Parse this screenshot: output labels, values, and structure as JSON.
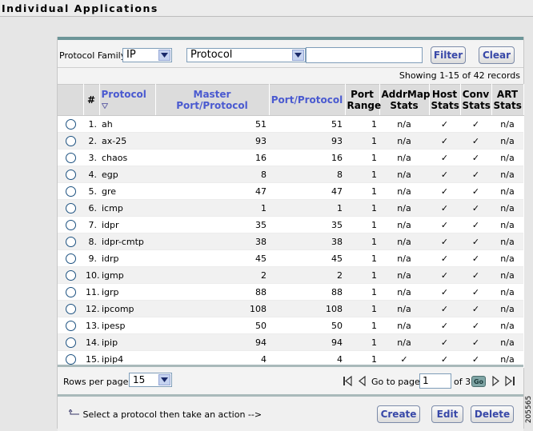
{
  "title": "Individual Applications",
  "filter": {
    "protocol_family_label": "Protocol Family:",
    "protocol_family_value": "IP",
    "field_value": "Protocol",
    "text_value": "",
    "filter_label": "Filter",
    "clear_label": "Clear"
  },
  "showing": "Showing 1-15 of 42 records",
  "columns": {
    "num": "#",
    "protocol": "Protocol",
    "master_port": "Master Port/Protocol",
    "port_protocol": "Port/Protocol",
    "port_range_1": "Port",
    "port_range_2": "Range",
    "addrmap_1": "AddrMap",
    "addrmap_2": "Stats",
    "host_1": "Host",
    "host_2": "Stats",
    "conv_1": "Conv",
    "conv_2": "Stats",
    "art_1": "ART",
    "art_2": "Stats"
  },
  "rows": [
    {
      "n": "1.",
      "protocol": "ah",
      "master": "51",
      "port": "51",
      "range": "1",
      "addrmap": "n/a",
      "host": "✓",
      "conv": "✓",
      "art": "n/a"
    },
    {
      "n": "2.",
      "protocol": "ax-25",
      "master": "93",
      "port": "93",
      "range": "1",
      "addrmap": "n/a",
      "host": "✓",
      "conv": "✓",
      "art": "n/a"
    },
    {
      "n": "3.",
      "protocol": "chaos",
      "master": "16",
      "port": "16",
      "range": "1",
      "addrmap": "n/a",
      "host": "✓",
      "conv": "✓",
      "art": "n/a"
    },
    {
      "n": "4.",
      "protocol": "egp",
      "master": "8",
      "port": "8",
      "range": "1",
      "addrmap": "n/a",
      "host": "✓",
      "conv": "✓",
      "art": "n/a"
    },
    {
      "n": "5.",
      "protocol": "gre",
      "master": "47",
      "port": "47",
      "range": "1",
      "addrmap": "n/a",
      "host": "✓",
      "conv": "✓",
      "art": "n/a"
    },
    {
      "n": "6.",
      "protocol": "icmp",
      "master": "1",
      "port": "1",
      "range": "1",
      "addrmap": "n/a",
      "host": "✓",
      "conv": "✓",
      "art": "n/a"
    },
    {
      "n": "7.",
      "protocol": "idpr",
      "master": "35",
      "port": "35",
      "range": "1",
      "addrmap": "n/a",
      "host": "✓",
      "conv": "✓",
      "art": "n/a"
    },
    {
      "n": "8.",
      "protocol": "idpr-cmtp",
      "master": "38",
      "port": "38",
      "range": "1",
      "addrmap": "n/a",
      "host": "✓",
      "conv": "✓",
      "art": "n/a"
    },
    {
      "n": "9.",
      "protocol": "idrp",
      "master": "45",
      "port": "45",
      "range": "1",
      "addrmap": "n/a",
      "host": "✓",
      "conv": "✓",
      "art": "n/a"
    },
    {
      "n": "10.",
      "protocol": "igmp",
      "master": "2",
      "port": "2",
      "range": "1",
      "addrmap": "n/a",
      "host": "✓",
      "conv": "✓",
      "art": "n/a"
    },
    {
      "n": "11.",
      "protocol": "igrp",
      "master": "88",
      "port": "88",
      "range": "1",
      "addrmap": "n/a",
      "host": "✓",
      "conv": "✓",
      "art": "n/a"
    },
    {
      "n": "12.",
      "protocol": "ipcomp",
      "master": "108",
      "port": "108",
      "range": "1",
      "addrmap": "n/a",
      "host": "✓",
      "conv": "✓",
      "art": "n/a"
    },
    {
      "n": "13.",
      "protocol": "ipesp",
      "master": "50",
      "port": "50",
      "range": "1",
      "addrmap": "n/a",
      "host": "✓",
      "conv": "✓",
      "art": "n/a"
    },
    {
      "n": "14.",
      "protocol": "ipip",
      "master": "94",
      "port": "94",
      "range": "1",
      "addrmap": "n/a",
      "host": "✓",
      "conv": "✓",
      "art": "n/a"
    },
    {
      "n": "15.",
      "protocol": "ipip4",
      "master": "4",
      "port": "4",
      "range": "1",
      "addrmap": "✓",
      "host": "✓",
      "conv": "✓",
      "art": "n/a"
    }
  ],
  "pager": {
    "rows_per_page_label": "Rows per page:",
    "rows_per_page_value": "15",
    "go_to_label": "Go to page:",
    "page_value": "1",
    "of_label": "of 3",
    "go_label": "Go"
  },
  "actions": {
    "hint": "Select a protocol then take an action -->",
    "create_label": "Create",
    "edit_label": "Edit",
    "delete_label": "Delete"
  },
  "figure_id": "205565",
  "colors": {
    "accent_teal": "#6d9598",
    "link_blue": "#4a5ad0",
    "button_text": "#3848a8"
  }
}
